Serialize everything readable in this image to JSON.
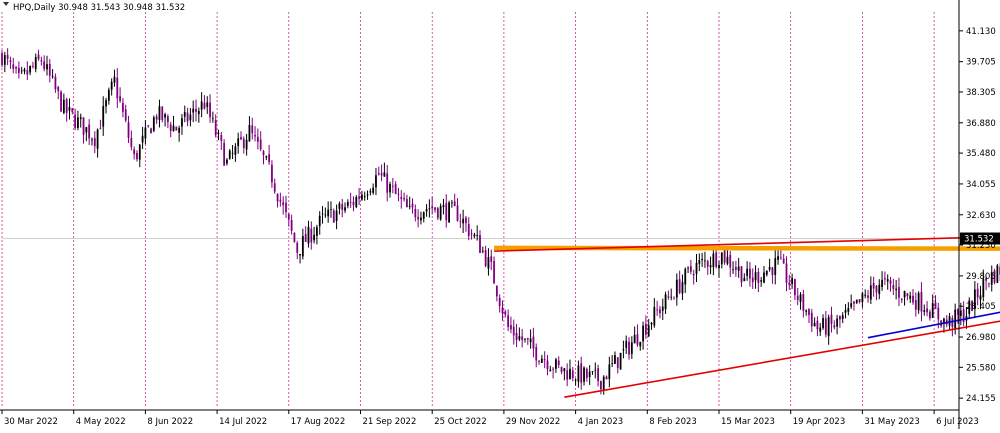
{
  "chart_data": {
    "type": "candlestick",
    "title": "HPQ,Daily  30.948 31.543 30.948 31.532",
    "symbol": "HPQ",
    "timeframe": "Daily",
    "ohlc_last": {
      "open": 30.948,
      "high": 31.543,
      "low": 30.948,
      "close": 31.532
    },
    "current_price": 31.532,
    "ylim": [
      23.7,
      42.0
    ],
    "y_ticks": [
      "41.130",
      "39.705",
      "38.305",
      "36.880",
      "35.480",
      "34.055",
      "32.630",
      "31.230",
      "29.805",
      "28.405",
      "26.980",
      "25.580",
      "24.155"
    ],
    "x_ticks": [
      "30 Mar 2022",
      "4 May 2022",
      "8 Jun 2022",
      "14 Jul 2022",
      "17 Aug 2022",
      "21 Sep 2022",
      "25 Oct 2022",
      "29 Nov 2022",
      "4 Jan 2023",
      "8 Feb 2023",
      "15 Mar 2023",
      "19 Apr 2023",
      "31 May 2023",
      "6 Jul 2023"
    ],
    "x_range_index": [
      0,
      340
    ],
    "grid": {
      "vertical": true,
      "horizontal": false,
      "style": "dotted"
    },
    "colors": {
      "bull": "#000000",
      "bear": "#800080",
      "grid": "#c71585",
      "price_line": "#c0c0c0",
      "price_tag_bg": "#000000",
      "price_tag_text": "#ffffff",
      "upper_trendline": "#e50000",
      "resistance_band": "#f5a000",
      "lower_support": "#e50000",
      "inner_support": "#0000cc"
    },
    "anchors": [
      [
        0,
        40.0
      ],
      [
        6,
        38.8
      ],
      [
        14,
        39.8
      ],
      [
        22,
        37.5
      ],
      [
        33,
        36.2
      ],
      [
        40,
        38.8
      ],
      [
        47,
        35.2
      ],
      [
        55,
        37.3
      ],
      [
        62,
        36.6
      ],
      [
        72,
        37.8
      ],
      [
        80,
        35.0
      ],
      [
        88,
        36.5
      ],
      [
        96,
        34.4
      ],
      [
        105,
        31.0
      ],
      [
        114,
        32.4
      ],
      [
        124,
        33.1
      ],
      [
        134,
        34.5
      ],
      [
        145,
        32.7
      ],
      [
        152,
        33.0
      ],
      [
        162,
        32.7
      ],
      [
        170,
        31.2
      ],
      [
        174,
        30.1
      ],
      [
        180,
        27.4
      ],
      [
        190,
        26.3
      ],
      [
        198,
        25.5
      ],
      [
        206,
        25.2
      ],
      [
        213,
        25.0
      ],
      [
        222,
        26.4
      ],
      [
        234,
        28.3
      ],
      [
        246,
        30.2
      ],
      [
        256,
        30.8
      ],
      [
        266,
        29.6
      ],
      [
        276,
        30.4
      ],
      [
        284,
        28.6
      ],
      [
        290,
        27.4
      ],
      [
        296,
        27.5
      ],
      [
        304,
        28.4
      ],
      [
        312,
        29.5
      ],
      [
        320,
        29.0
      ],
      [
        328,
        28.5
      ],
      [
        336,
        27.6
      ],
      [
        343,
        28.1
      ],
      [
        350,
        29.6
      ],
      [
        358,
        30.4
      ],
      [
        366,
        30.7
      ],
      [
        374,
        30.1
      ],
      [
        384,
        31.3
      ],
      [
        392,
        29.8
      ],
      [
        402,
        31.2
      ],
      [
        410,
        30.1
      ],
      [
        418,
        29.4
      ],
      [
        426,
        30.8
      ],
      [
        430,
        30.3
      ],
      [
        440,
        31.4
      ]
    ],
    "levels": [
      {
        "name": "resistance-band",
        "from": [
          175,
          31.1
        ],
        "to": [
          440,
          31.05
        ]
      },
      {
        "name": "upper-trendline",
        "from": [
          175,
          30.95
        ],
        "to": [
          444,
          31.95
        ]
      },
      {
        "name": "lower-support",
        "from": [
          200,
          24.2
        ],
        "to": [
          445,
          29.75
        ]
      },
      {
        "name": "inner-support",
        "from": [
          308,
          26.95
        ],
        "to": [
          442,
          30.3
        ]
      }
    ]
  }
}
